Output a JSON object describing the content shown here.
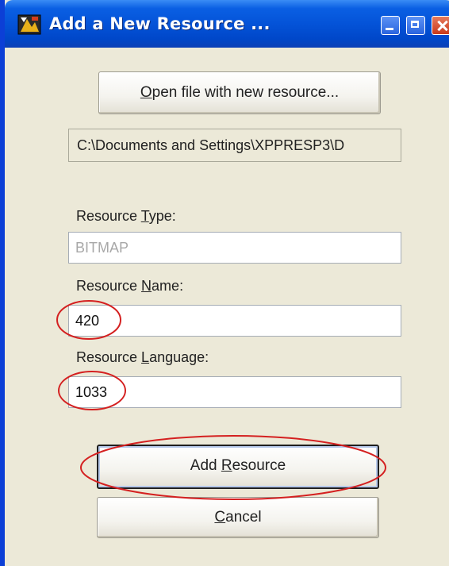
{
  "window": {
    "title": "Add a New Resource ..."
  },
  "open_file_button": {
    "mnemonic": "O",
    "rest": "pen file with new resource..."
  },
  "path": {
    "value": "C:\\Documents and Settings\\XPPRESP3\\D"
  },
  "resource_type": {
    "label_prefix": "Resource ",
    "label_mnemonic": "T",
    "label_rest": "ype:",
    "value": "BITMAP"
  },
  "resource_name": {
    "label_prefix": "Resource ",
    "label_mnemonic": "N",
    "label_rest": "ame:",
    "value": "420"
  },
  "resource_language": {
    "label_prefix": "Resource ",
    "label_mnemonic": "L",
    "label_rest": "anguage:",
    "value": "1033"
  },
  "add_button": {
    "prefix": "Add ",
    "mnemonic": "R",
    "rest": "esource"
  },
  "cancel_button": {
    "mnemonic": "C",
    "rest": "ancel"
  },
  "colors": {
    "titlebar": "#0453d8",
    "annotation": "#d42020",
    "dialog_bg": "#ece9d8"
  }
}
